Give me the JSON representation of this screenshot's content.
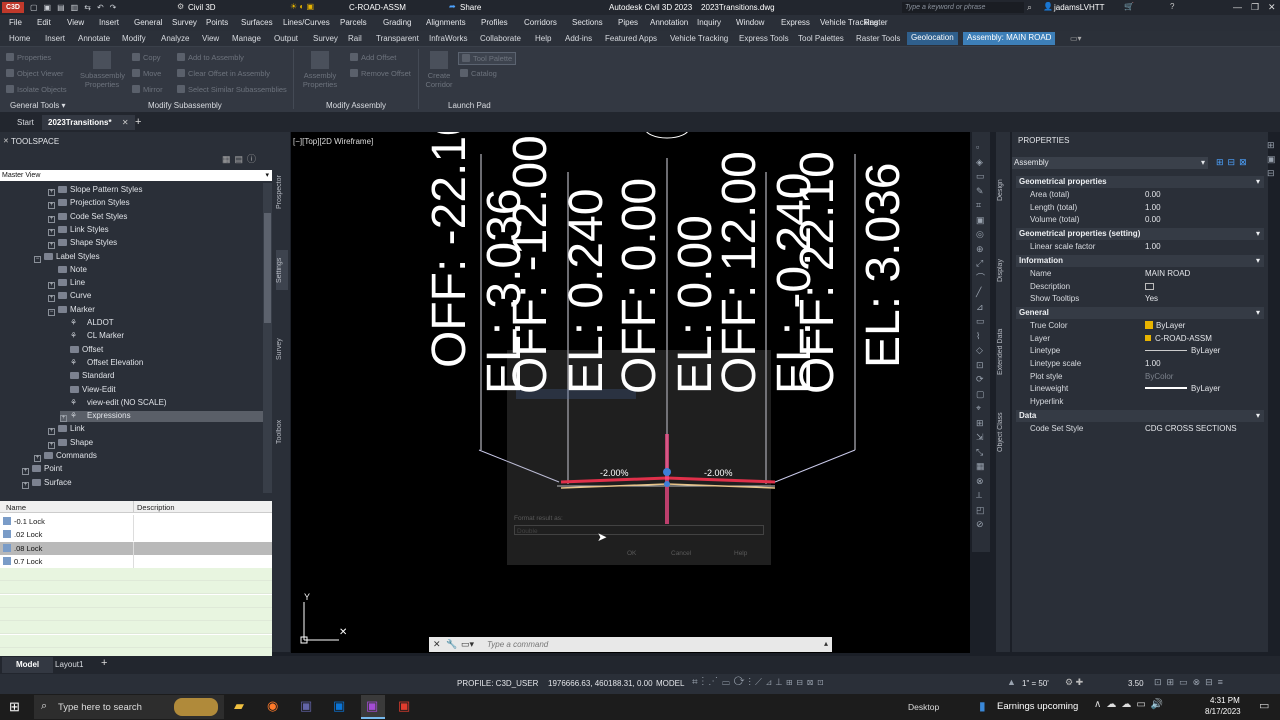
{
  "title": {
    "product": "Civil 3D",
    "layer": "C-ROAD-ASSM",
    "share": "Share",
    "window": "Autodesk Civil 3D 2023    2023Transitions.dwg",
    "search_placeholder": "Type a keyword or phrase",
    "user": "jadamsLVHTT"
  },
  "menu": [
    "File",
    "Edit",
    "View",
    "Insert",
    "General",
    "Survey",
    "Points",
    "Surfaces",
    "Lines/Curves",
    "Parcels",
    "Grading",
    "Alignments",
    "Profiles",
    "Corridors",
    "Sections",
    "Pipes",
    "Annotation",
    "Inquiry",
    "Window",
    "Express",
    "Vehicle Tracking",
    "Raster"
  ],
  "ribbon_tabs": [
    "Home",
    "Insert",
    "Annotate",
    "Modify",
    "Analyze",
    "View",
    "Manage",
    "Output",
    "Survey",
    "Rail",
    "Transparent",
    "InfraWorks",
    "Collaborate",
    "Help",
    "Add-ins",
    "Featured Apps",
    "Vehicle Tracking",
    "Express Tools",
    "Tool Palettes",
    "Raster Tools",
    "Geolocation",
    "Assembly: MAIN ROAD"
  ],
  "ribbon": {
    "general_tools": [
      "Properties",
      "Object Viewer",
      "Isolate Objects"
    ],
    "subassembly_properties": "Subassembly Properties",
    "modify_sub": [
      "Copy",
      "Move",
      "Mirror"
    ],
    "modify_sub2": [
      "Add to Assembly",
      "Clear Offset in Assembly",
      "Select Similar Subassemblies"
    ],
    "assembly_properties": "Assembly Properties",
    "modify_asm": [
      "Add Offset",
      "Remove Offset"
    ],
    "create_corridor": "Create Corridor",
    "launch": [
      "Tool Palette",
      "Catalog"
    ],
    "panels": [
      "General Tools",
      "Modify Subassembly",
      "Modify Assembly",
      "Launch Pad"
    ]
  },
  "doc_tabs": [
    "Start",
    "2023Transitions*"
  ],
  "toolspace": {
    "title": "TOOLSPACE",
    "view": "Master View",
    "tree": [
      "Slope Pattern Styles",
      "Projection Styles",
      "Code Set Styles",
      "Link Styles",
      "Shape Styles",
      "Label Styles",
      "Note",
      "Line",
      "Curve",
      "Marker",
      "ALDOT",
      "CL Marker",
      "Offset",
      "Offset Elevation",
      "Standard",
      "View-Edit",
      "view-edit (NO SCALE)",
      "Expressions",
      "Link",
      "Shape",
      "Commands",
      "Point",
      "Surface"
    ],
    "side_tabs": [
      "Prospector",
      "Settings",
      "Survey",
      "Toolbox"
    ],
    "list_headers": [
      "Name",
      "Description"
    ],
    "list_rows": [
      "-0.1 Lock",
      ".02 Lock",
      ".08 Lock",
      "0.7 Lock"
    ]
  },
  "viewport": {
    "label": "[−][Top][2D Wireframe]",
    "labels": [
      "OFF: -22.10",
      "EL: 3.036",
      "OFF: -12.00",
      "EL: 0.240",
      "OFF: 0.00",
      "EL: 0.00",
      "OFF: 12.00",
      "EL: -0.240",
      "OFF: 22.10",
      "EL: 3.036"
    ],
    "slope_left": "-2.00%",
    "slope_right": "-2.00%",
    "dialog_format_label": "Format result as:",
    "dialog_format_value": "Double",
    "dialog_buttons": [
      "OK",
      "Cancel",
      "Help"
    ],
    "command_placeholder": "Type a command"
  },
  "properties": {
    "title": "PROPERTIES",
    "selector": "Assembly",
    "side_tabs": [
      "Design",
      "Display",
      "Extended Data",
      "Object Class"
    ],
    "sections": [
      {
        "name": "Geometrical properties",
        "rows": [
          [
            "Area (total)",
            "0.00"
          ],
          [
            "Length (total)",
            "1.00"
          ],
          [
            "Volume (total)",
            "0.00"
          ]
        ]
      },
      {
        "name": "Geometrical properties (setting)",
        "rows": [
          [
            "Linear scale factor",
            "1.00"
          ]
        ]
      },
      {
        "name": "Information",
        "rows": [
          [
            "Name",
            "MAIN ROAD"
          ],
          [
            "Description",
            ""
          ],
          [
            "Show Tooltips",
            "Yes"
          ]
        ]
      },
      {
        "name": "General",
        "rows": [
          [
            "True Color",
            "ByLayer"
          ],
          [
            "Layer",
            "C-ROAD-ASSM"
          ],
          [
            "Linetype",
            "ByLayer"
          ],
          [
            "Linetype scale",
            "1.00"
          ],
          [
            "Plot style",
            "ByColor"
          ],
          [
            "Lineweight",
            "ByLayer"
          ],
          [
            "Hyperlink",
            ""
          ]
        ]
      },
      {
        "name": "Data",
        "rows": [
          [
            "Code Set Style",
            "CDG CROSS SECTIONS"
          ]
        ]
      }
    ]
  },
  "layout_tabs": [
    "Model",
    "Layout1"
  ],
  "status": {
    "profile": "PROFILE: C3D_USER",
    "coords": "1976666.63, 460188.31, 0.00",
    "space": "MODEL",
    "scale": "1\" = 50'",
    "zoom": "3.50"
  },
  "taskbar": {
    "search": "Type here to search",
    "desktop": "Desktop",
    "news": "Earnings upcoming",
    "time": "4:31 PM",
    "date": "8/17/2023"
  },
  "colors": {
    "accent": "#3d7fb8",
    "assembly_red": "#e0304a",
    "layer_yellow": "#e8b400"
  }
}
